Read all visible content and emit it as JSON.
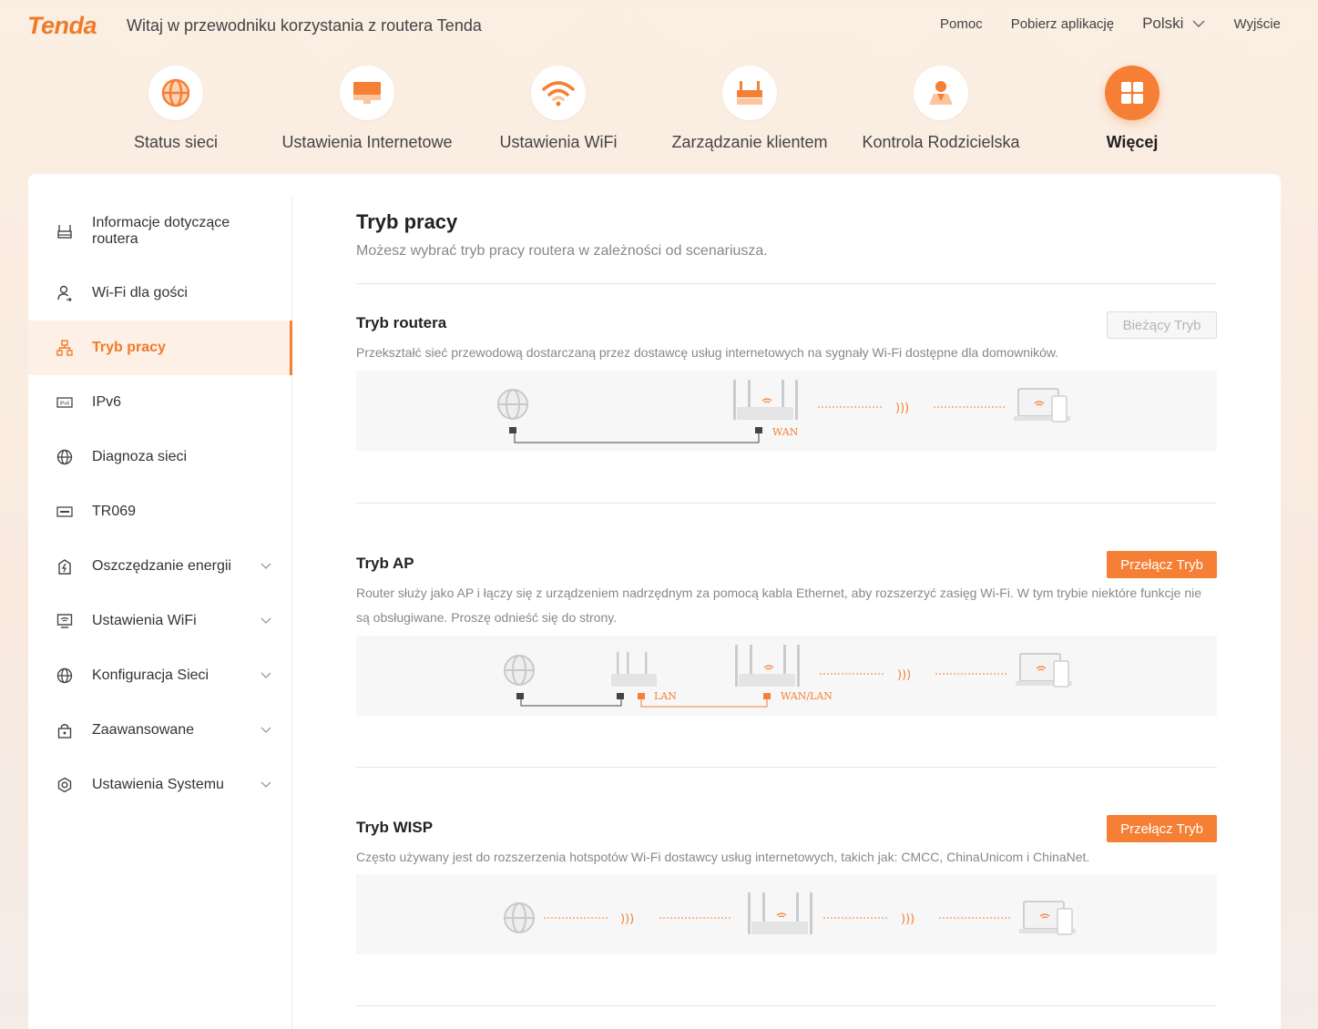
{
  "header": {
    "logo": "Tenda",
    "welcome": "Witaj w przewodniku korzystania z routera Tenda",
    "links": {
      "help": "Pomoc",
      "download": "Pobierz aplikację",
      "language": "Polski",
      "logout": "Wyjście"
    }
  },
  "nav": [
    {
      "label": "Status sieci",
      "icon": "globe-icon"
    },
    {
      "label": "Ustawienia Internetowe",
      "icon": "monitor-icon"
    },
    {
      "label": "Ustawienia WiFi",
      "icon": "wifi-icon"
    },
    {
      "label": "Zarządzanie klientem",
      "icon": "router-icon"
    },
    {
      "label": "Kontrola Rodzicielska",
      "icon": "parent-icon"
    },
    {
      "label": "Więcej",
      "icon": "grid-icon",
      "active": true
    }
  ],
  "sidebar": [
    {
      "label": "Informacje dotyczące routera",
      "icon": "router-info-icon"
    },
    {
      "label": "Wi-Fi dla gości",
      "icon": "guest-icon"
    },
    {
      "label": "Tryb pracy",
      "icon": "mode-icon",
      "active": true
    },
    {
      "label": "IPv6",
      "icon": "ipv6-icon"
    },
    {
      "label": "Diagnoza sieci",
      "icon": "globe-icon"
    },
    {
      "label": "TR069",
      "icon": "tr069-icon"
    },
    {
      "label": "Oszczędzanie energii",
      "icon": "energy-icon",
      "expandable": true
    },
    {
      "label": "Ustawienia WiFi",
      "icon": "wifi-settings-icon",
      "expandable": true
    },
    {
      "label": "Konfiguracja Sieci",
      "icon": "globe-icon",
      "expandable": true
    },
    {
      "label": "Zaawansowane",
      "icon": "lock-icon",
      "expandable": true
    },
    {
      "label": "Ustawienia Systemu",
      "icon": "gear-icon",
      "expandable": true
    }
  ],
  "main": {
    "title": "Tryb pracy",
    "subtitle": "Możesz wybrać tryb pracy routera w zależności od scenariusza.",
    "modes": [
      {
        "title": "Tryb routera",
        "description": "Przekształć sieć przewodową dostarczaną przez dostawcę usług internetowych na sygnały Wi-Fi dostępne dla domowników.",
        "button": "Bieżący Tryb",
        "current": true,
        "port_labels": [
          "WAN"
        ]
      },
      {
        "title": "Tryb AP",
        "description": "Router służy jako AP i łączy się z urządzeniem nadrzędnym za pomocą kabla Ethernet, aby rozszerzyć zasięg Wi-Fi. W tym trybie niektóre funkcje nie są obsługiwane. Proszę odnieść się do strony.",
        "button": "Przełącz Tryb",
        "current": false,
        "port_labels": [
          "LAN",
          "WAN/LAN"
        ]
      },
      {
        "title": "Tryb WISP",
        "description": "Często używany jest do rozszerzenia hotspotów Wi-Fi dostawcy usług internetowych, takich jak: CMCC, ChinaUnicom i ChinaNet.",
        "button": "Przełącz Tryb",
        "current": false,
        "port_labels": []
      }
    ]
  },
  "colors": {
    "accent": "#f57f34",
    "active_bg": "#fdf0e6",
    "muted_text": "#888888"
  }
}
